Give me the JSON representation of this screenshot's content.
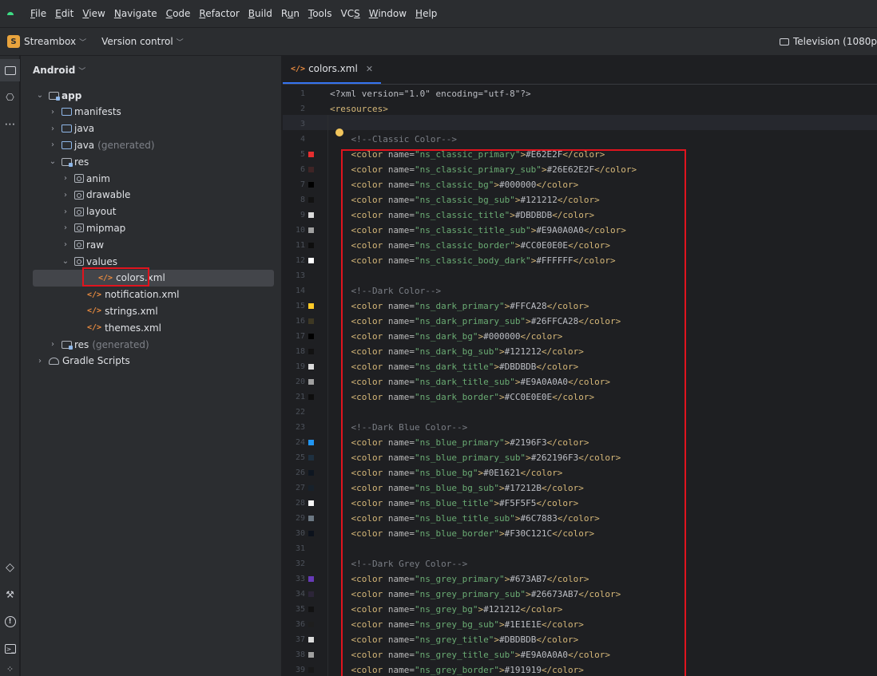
{
  "menu": {
    "items": [
      {
        "mn": "F",
        "rest": "ile"
      },
      {
        "mn": "E",
        "rest": "dit"
      },
      {
        "mn": "V",
        "rest": "iew"
      },
      {
        "mn": "N",
        "rest": "avigate"
      },
      {
        "mn": "C",
        "rest": "ode"
      },
      {
        "mn": "R",
        "rest": "efactor"
      },
      {
        "mn": "B",
        "rest": "uild"
      },
      {
        "pre": "R",
        "mn": "u",
        "rest": "n"
      },
      {
        "mn": "T",
        "rest": "ools"
      },
      {
        "pre": "VC",
        "mn": "S",
        "rest": ""
      },
      {
        "mn": "W",
        "rest": "indow"
      },
      {
        "mn": "H",
        "rest": "elp"
      }
    ]
  },
  "toolbar": {
    "project_badge": "S",
    "project_name": "Streambox",
    "version_control": "Version control",
    "device": "Television (1080p"
  },
  "panel": {
    "title": "Android"
  },
  "tree": [
    {
      "label": "app",
      "icon": "module",
      "indent": 0,
      "expanded": true,
      "bold": true
    },
    {
      "label": "manifests",
      "icon": "folder",
      "indent": 1,
      "expanded": false
    },
    {
      "label": "java",
      "icon": "folder",
      "indent": 1,
      "expanded": false
    },
    {
      "label": "java",
      "suffix": "(generated)",
      "icon": "folder",
      "indent": 1,
      "expanded": false
    },
    {
      "label": "res",
      "icon": "module",
      "indent": 1,
      "expanded": true
    },
    {
      "label": "anim",
      "icon": "package",
      "indent": 2,
      "expanded": false
    },
    {
      "label": "drawable",
      "icon": "package",
      "indent": 2,
      "expanded": false
    },
    {
      "label": "layout",
      "icon": "package",
      "indent": 2,
      "expanded": false
    },
    {
      "label": "mipmap",
      "icon": "package",
      "indent": 2,
      "expanded": false
    },
    {
      "label": "raw",
      "icon": "package",
      "indent": 2,
      "expanded": false
    },
    {
      "label": "values",
      "icon": "package",
      "indent": 2,
      "expanded": true
    },
    {
      "label": "colors.xml",
      "icon": "xml",
      "indent": 3,
      "selected": true
    },
    {
      "label": "notification.xml",
      "icon": "xml",
      "indent": 3
    },
    {
      "label": "strings.xml",
      "icon": "xml",
      "indent": 3
    },
    {
      "label": "themes.xml",
      "icon": "xml",
      "indent": 3
    },
    {
      "label": "res",
      "suffix": "(generated)",
      "icon": "module",
      "indent": 1,
      "expanded": false
    },
    {
      "label": "Gradle Scripts",
      "icon": "gradle",
      "indent": 0,
      "expanded": false
    }
  ],
  "editor": {
    "tab": "colors.xml",
    "xml_decl": "<?xml version=\"1.0\" encoding=\"utf-8\"?>",
    "root_open": "<resources>",
    "groups": [
      {
        "comment": "<!--Classic Color-->",
        "colors": [
          {
            "name": "ns_classic_primary",
            "value": "#E62E2F",
            "swatch": "#e62e2f"
          },
          {
            "name": "ns_classic_primary_sub",
            "value": "#26E62E2F",
            "swatch": "#3f2425"
          },
          {
            "name": "ns_classic_bg",
            "value": "#000000",
            "swatch": "#000000"
          },
          {
            "name": "ns_classic_bg_sub",
            "value": "#121212",
            "swatch": "#121212"
          },
          {
            "name": "ns_classic_title",
            "value": "#DBDBDB",
            "swatch": "#dbdbdb"
          },
          {
            "name": "ns_classic_title_sub",
            "value": "#E9A0A0A0",
            "swatch": "#a0a0a0"
          },
          {
            "name": "ns_classic_border",
            "value": "#CC0E0E0E",
            "swatch": "#0e0e0e"
          },
          {
            "name": "ns_classic_body_dark",
            "value": "#FFFFFF",
            "swatch": "#ffffff"
          }
        ]
      },
      {
        "comment": "<!--Dark Color-->",
        "colors": [
          {
            "name": "ns_dark_primary",
            "value": "#FFCA28",
            "swatch": "#ffca28"
          },
          {
            "name": "ns_dark_primary_sub",
            "value": "#26FFCA28",
            "swatch": "#3e3823"
          },
          {
            "name": "ns_dark_bg",
            "value": "#000000",
            "swatch": "#000000"
          },
          {
            "name": "ns_dark_bg_sub",
            "value": "#121212",
            "swatch": "#121212"
          },
          {
            "name": "ns_dark_title",
            "value": "#DBDBDB",
            "swatch": "#dbdbdb"
          },
          {
            "name": "ns_dark_title_sub",
            "value": "#E9A0A0A0",
            "swatch": "#a0a0a0"
          },
          {
            "name": "ns_dark_border",
            "value": "#CC0E0E0E",
            "swatch": "#0e0e0e"
          }
        ]
      },
      {
        "comment": "<!--Dark Blue Color-->",
        "colors": [
          {
            "name": "ns_blue_primary",
            "value": "#2196F3",
            "swatch": "#2196f3"
          },
          {
            "name": "ns_blue_primary_sub",
            "value": "#262196F3",
            "swatch": "#1e3040"
          },
          {
            "name": "ns_blue_bg",
            "value": "#0E1621",
            "swatch": "#0e1621"
          },
          {
            "name": "ns_blue_bg_sub",
            "value": "#17212B",
            "swatch": "#17212b"
          },
          {
            "name": "ns_blue_title",
            "value": "#F5F5F5",
            "swatch": "#f5f5f5"
          },
          {
            "name": "ns_blue_title_sub",
            "value": "#6C7883",
            "swatch": "#6c7883"
          },
          {
            "name": "ns_blue_border",
            "value": "#F30C121C",
            "swatch": "#0c121c"
          }
        ]
      },
      {
        "comment": "<!--Dark Grey Color-->",
        "colors": [
          {
            "name": "ns_grey_primary",
            "value": "#673AB7",
            "swatch": "#673ab7"
          },
          {
            "name": "ns_grey_primary_sub",
            "value": "#26673AB7",
            "swatch": "#2c2538"
          },
          {
            "name": "ns_grey_bg",
            "value": "#121212",
            "swatch": "#121212"
          },
          {
            "name": "ns_grey_bg_sub",
            "value": "#1E1E1E",
            "swatch": "#1e1e1e"
          },
          {
            "name": "ns_grey_title",
            "value": "#DBDBDB",
            "swatch": "#dbdbdb"
          },
          {
            "name": "ns_grey_title_sub",
            "value": "#E9A0A0A0",
            "swatch": "#a0a0a0"
          },
          {
            "name": "ns_grey_border",
            "value": "#191919",
            "swatch": "#191919"
          }
        ]
      }
    ]
  },
  "colors": {
    "highlight_box": "#e0141e",
    "tag": "#d5b778",
    "attr_value": "#6aab73",
    "comment": "#7a7e85"
  }
}
